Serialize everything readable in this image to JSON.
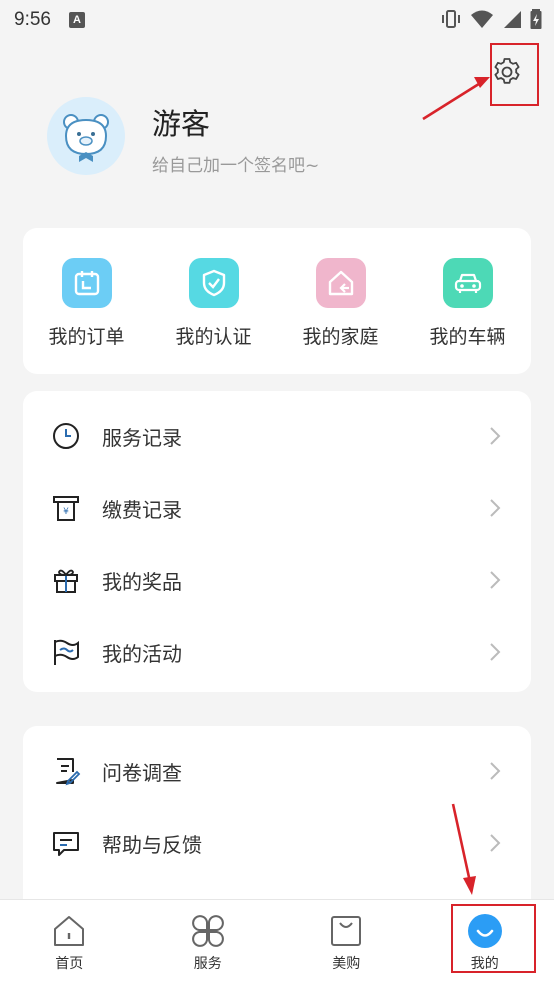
{
  "status_bar": {
    "time": "9:56",
    "notification_badge": "A"
  },
  "profile": {
    "username": "游客",
    "signature": "给自己加一个签名吧~"
  },
  "quick_actions": [
    {
      "label": "我的订单",
      "icon": "calendar-order-icon",
      "color": "#6ccdf5"
    },
    {
      "label": "我的认证",
      "icon": "shield-check-icon",
      "color": "#56d9e3"
    },
    {
      "label": "我的家庭",
      "icon": "house-icon",
      "color": "#f0b6cc"
    },
    {
      "label": "我的车辆",
      "icon": "car-icon",
      "color": "#4dd9b6"
    }
  ],
  "menu_group_1": [
    {
      "label": "服务记录",
      "icon": "clock-icon"
    },
    {
      "label": "缴费记录",
      "icon": "receipt-icon"
    },
    {
      "label": "我的奖品",
      "icon": "gift-icon"
    },
    {
      "label": "我的活动",
      "icon": "flag-icon"
    }
  ],
  "menu_group_2": [
    {
      "label": "问卷调查",
      "icon": "survey-icon"
    },
    {
      "label": "帮助与反馈",
      "icon": "feedback-icon"
    }
  ],
  "bottom_nav": [
    {
      "label": "首页",
      "icon": "home-icon"
    },
    {
      "label": "服务",
      "icon": "grid-icon"
    },
    {
      "label": "美购",
      "icon": "shopping-bag-icon"
    },
    {
      "label": "我的",
      "icon": "smile-icon",
      "active": true
    }
  ],
  "colors": {
    "annotation_red": "#d8232a",
    "active_tab": "#2b9df5"
  }
}
